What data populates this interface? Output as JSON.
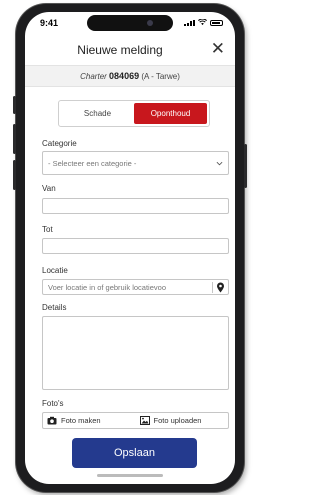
{
  "status_bar": {
    "time": "9:41"
  },
  "header": {
    "title": "Nieuwe melding",
    "close_icon": "close-icon"
  },
  "charter": {
    "label": "Charter",
    "number": "084069",
    "suffix": "(A - Tarwe)"
  },
  "tabs": [
    {
      "label": "Schade",
      "active": false
    },
    {
      "label": "Oponthoud",
      "active": true
    }
  ],
  "form": {
    "categorie": {
      "label": "Categorie",
      "placeholder": "- Selecteer een categorie -"
    },
    "van": {
      "label": "Van",
      "value": ""
    },
    "tot": {
      "label": "Tot",
      "value": ""
    },
    "locatie": {
      "label": "Locatie",
      "placeholder": "Voer locatie in of gebruik locatievoo"
    },
    "details": {
      "label": "Details",
      "value": ""
    },
    "fotos": {
      "label": "Foto's",
      "take": "Foto maken",
      "upload": "Foto uploaden"
    }
  },
  "save_button": "Opslaan",
  "colors": {
    "accent_red": "#c8171d",
    "primary_blue": "#243a8e"
  }
}
